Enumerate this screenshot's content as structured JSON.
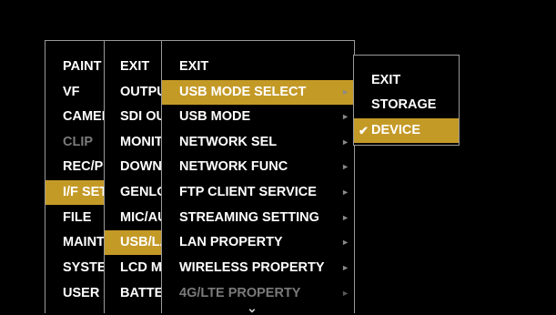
{
  "col1": {
    "items": [
      {
        "label": "PAINT"
      },
      {
        "label": "VF"
      },
      {
        "label": "CAMERA"
      },
      {
        "label": "CLIP"
      },
      {
        "label": "REC/PB"
      },
      {
        "label": "I/F SETUP"
      },
      {
        "label": "FILE"
      },
      {
        "label": "MAINTENANCE"
      },
      {
        "label": "SYSTEM"
      },
      {
        "label": "USER"
      }
    ]
  },
  "col2": {
    "items": [
      {
        "label": "EXIT"
      },
      {
        "label": "OUTPUT"
      },
      {
        "label": "SDI OUT"
      },
      {
        "label": "MONITOR"
      },
      {
        "label": "DOWN CONV"
      },
      {
        "label": "GENLOCK"
      },
      {
        "label": "MIC/AUDIO"
      },
      {
        "label": "USB/LAN"
      },
      {
        "label": "LCD MONITOR"
      },
      {
        "label": "BATTERY"
      }
    ]
  },
  "col3": {
    "items": [
      {
        "label": "EXIT"
      },
      {
        "label": "USB MODE SELECT"
      },
      {
        "label": "USB MODE"
      },
      {
        "label": "NETWORK SEL"
      },
      {
        "label": "NETWORK FUNC"
      },
      {
        "label": "FTP CLIENT SERVICE"
      },
      {
        "label": "STREAMING SETTING"
      },
      {
        "label": "LAN PROPERTY"
      },
      {
        "label": "WIRELESS PROPERTY"
      },
      {
        "label": "4G/LTE PROPERTY"
      }
    ],
    "arrow_glyph": "►"
  },
  "col4": {
    "items": [
      {
        "label": "EXIT"
      },
      {
        "label": "STORAGE"
      },
      {
        "label": "DEVICE"
      }
    ],
    "check_glyph": "✔"
  },
  "scroll_glyph": "⌄",
  "colors": {
    "highlight": "#c49a27",
    "border": "#9a9a9a",
    "dim": "#7a7a7a"
  }
}
